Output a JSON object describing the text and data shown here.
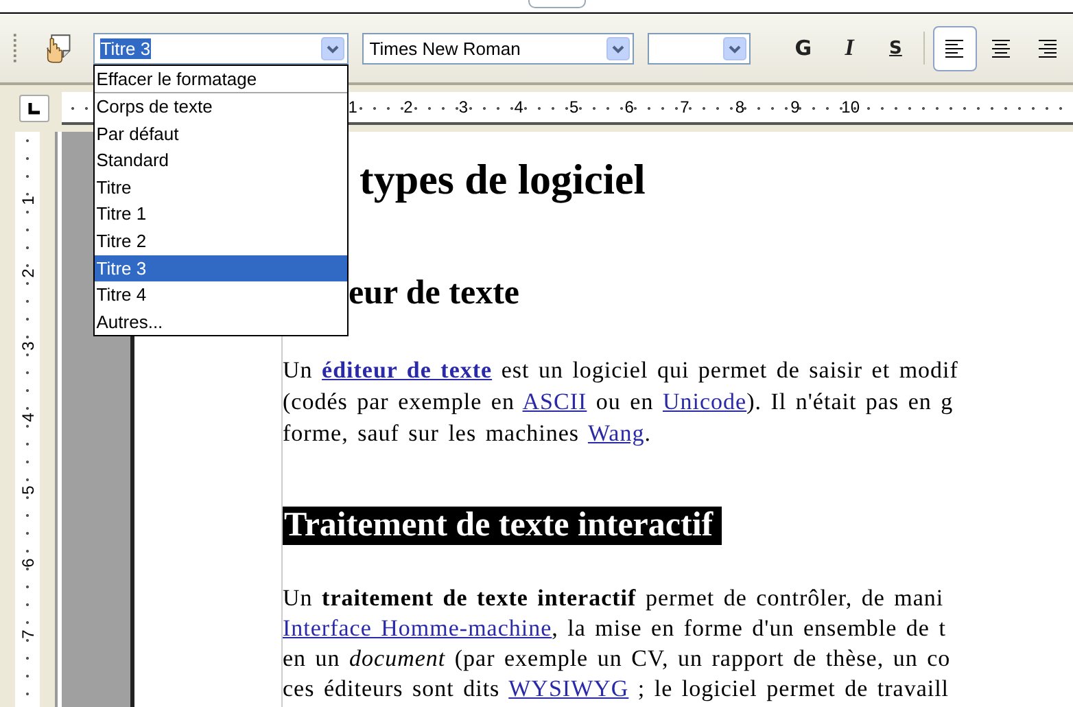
{
  "toolbar": {
    "style_box": {
      "value": "Titre 3",
      "open": true
    },
    "font_box": {
      "value": "Times New Roman"
    },
    "format_buttons": [
      {
        "label": "G",
        "kind": "bold"
      },
      {
        "label": "I",
        "kind": "italic"
      },
      {
        "label": "S",
        "kind": "underline"
      }
    ],
    "align_buttons": [
      {
        "kind": "left",
        "selected": true
      },
      {
        "kind": "center",
        "selected": false
      },
      {
        "kind": "right",
        "selected": false
      }
    ]
  },
  "style_list": [
    {
      "label": "Effacer le formatage",
      "selected": false
    },
    {
      "label": "Corps de texte",
      "selected": false
    },
    {
      "label": "Par défaut",
      "selected": false
    },
    {
      "label": "Standard",
      "selected": false
    },
    {
      "label": "Titre",
      "selected": false
    },
    {
      "label": "Titre 1",
      "selected": false
    },
    {
      "label": "Titre 2",
      "selected": false
    },
    {
      "label": "Titre 3",
      "selected": true
    },
    {
      "label": "Titre 4",
      "selected": false
    },
    {
      "label": "Autres...",
      "selected": false
    }
  ],
  "ruler": {
    "marks": [
      "1",
      "2",
      "3",
      "4",
      "5",
      "6",
      "7",
      "8",
      "9",
      "10"
    ]
  },
  "vertical_ruler": {
    "marks": [
      "1",
      "2",
      "3",
      "4",
      "5",
      "6",
      "7"
    ]
  },
  "document": {
    "blocks": [
      {
        "kind": "heading1",
        "text": "types de logiciel"
      },
      {
        "kind": "heading3",
        "text": "eur de texte"
      },
      {
        "kind": "paragraph",
        "lines": [
          [
            {
              "kind": "text",
              "text": "Un "
            },
            {
              "kind": "bold-link",
              "text": "éditeur de texte"
            },
            {
              "kind": "text",
              "text": " est un logiciel qui permet de saisir et modif"
            }
          ],
          [
            {
              "kind": "text",
              "text": "(codés par exemple en "
            },
            {
              "kind": "link",
              "text": "ASCII"
            },
            {
              "kind": "text",
              "text": " ou en "
            },
            {
              "kind": "link",
              "text": "Unicode"
            },
            {
              "kind": "text",
              "text": "). Il n'était pas en g"
            }
          ],
          [
            {
              "kind": "text",
              "text": "forme, sauf sur les machines "
            },
            {
              "kind": "link",
              "text": "Wang"
            },
            {
              "kind": "text",
              "text": "."
            }
          ]
        ]
      },
      {
        "kind": "heading2",
        "text": "Traitement de texte interactif",
        "highlighted": true
      },
      {
        "kind": "paragraph",
        "lines": [
          [
            {
              "kind": "text",
              "text": "Un "
            },
            {
              "kind": "bold",
              "text": "traitement de texte interactif"
            },
            {
              "kind": "text",
              "text": " permet de contrôler, de mani"
            }
          ],
          [
            {
              "kind": "link",
              "text": "Interface Homme-machine"
            },
            {
              "kind": "text",
              "text": ", la mise en forme d'un ensemble de t"
            }
          ],
          [
            {
              "kind": "text",
              "text": "en un "
            },
            {
              "kind": "italic",
              "text": "document"
            },
            {
              "kind": "text",
              "text": " (par exemple un CV, un rapport de thèse, un co"
            }
          ],
          [
            {
              "kind": "text",
              "text": "ces éditeurs sont dits "
            },
            {
              "kind": "link",
              "text": "WYSIWYG"
            },
            {
              "kind": "text",
              "text": " ; le logiciel permet de travaill"
            }
          ]
        ]
      }
    ]
  }
}
